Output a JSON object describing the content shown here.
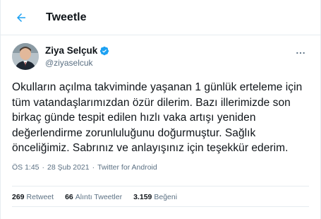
{
  "header": {
    "title": "Tweetle"
  },
  "author": {
    "name": "Ziya Selçuk",
    "handle": "@ziyaselcuk"
  },
  "tweet": {
    "text": "Okulların açılma takviminde yaşanan 1 günlük erteleme için tüm vatandaşlarımızdan özür dilerim. Bazı illerimizde son birkaç günde tespit edilen hızlı vaka artışı yeniden değerlendirme zorunluluğunu doğurmuştur. Sağlık önceliğimiz. Sabrınız ve anlayışınız için teşekkür ederim.",
    "time": "ÖS 1:45",
    "dot": "·",
    "date": "28 Şub 2021",
    "source": "Twitter for Android"
  },
  "stats": {
    "retweets": {
      "count": "269",
      "label": "Retweet"
    },
    "quotes": {
      "count": "66",
      "label": "Alıntı Tweetler"
    },
    "likes": {
      "count": "3.159",
      "label": "Beğeni"
    }
  },
  "colors": {
    "accent": "#1da1f2",
    "muted": "#5b7083",
    "border": "#e6ecf0"
  },
  "icons": {
    "back": "arrow-left-icon",
    "verified": "verified-badge-icon",
    "more": "more-horizontal-icon"
  }
}
